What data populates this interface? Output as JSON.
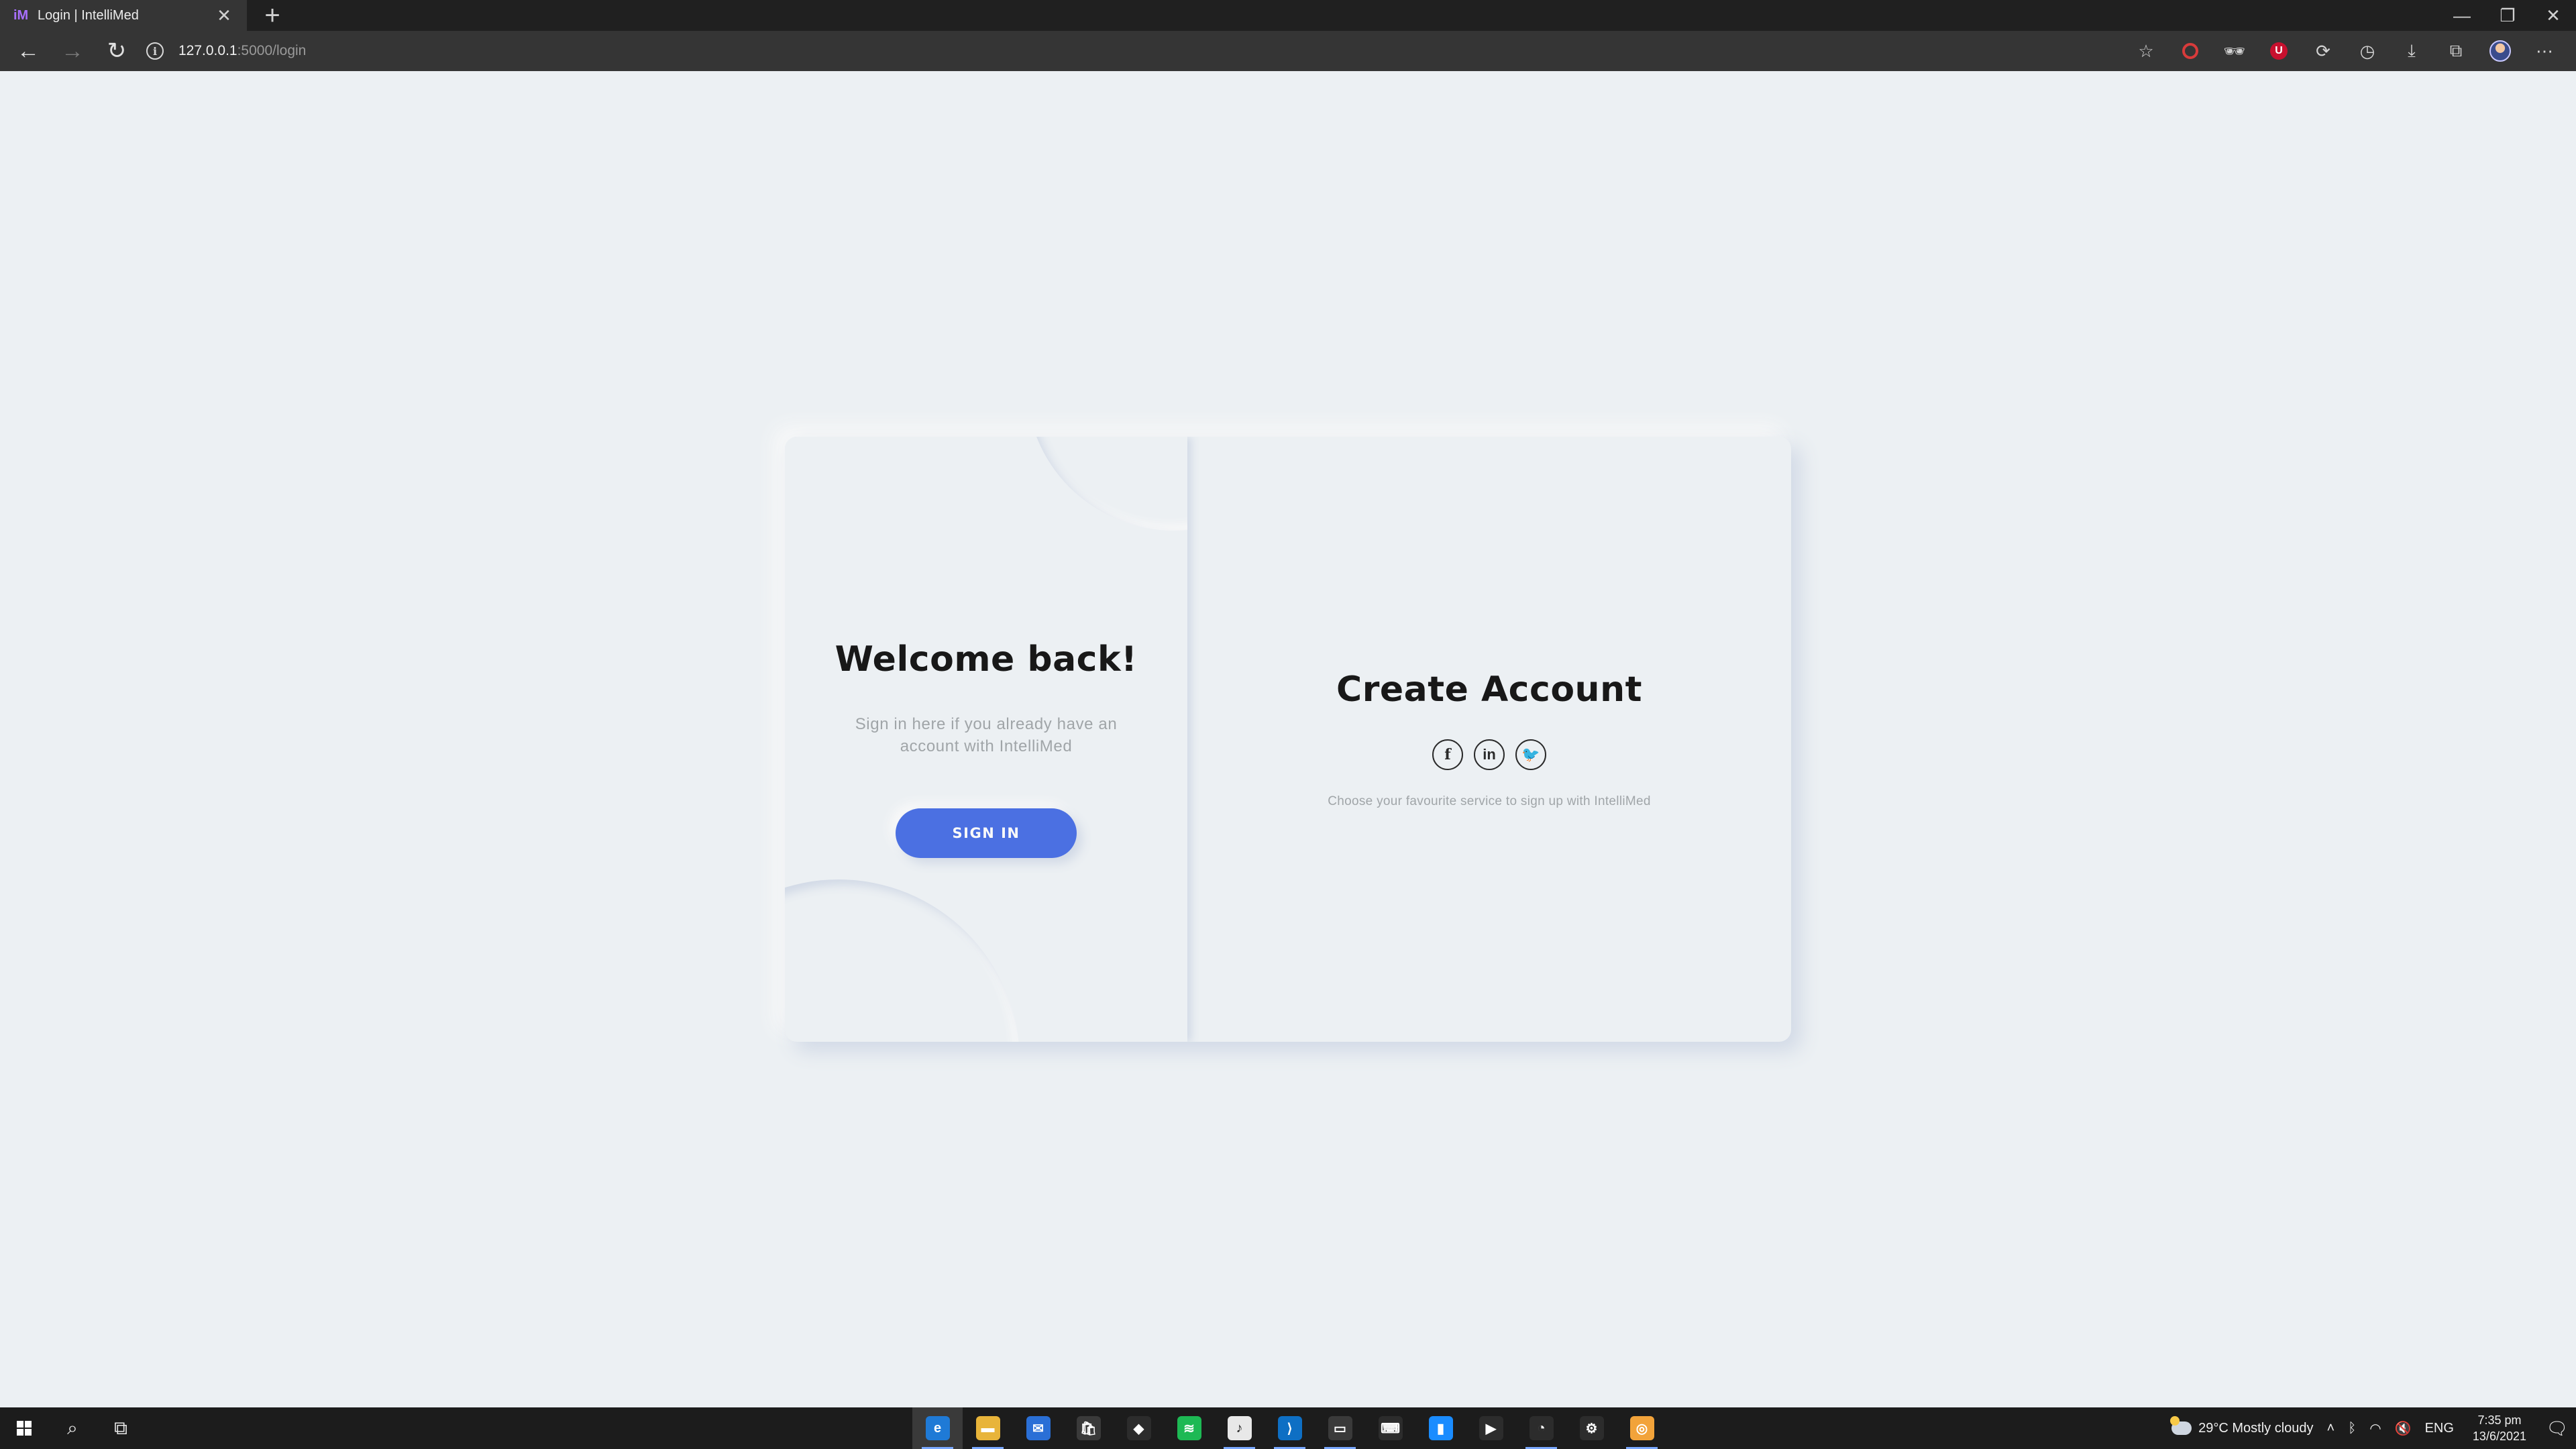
{
  "browser": {
    "tab_favicon": "iM",
    "tab_title": "Login | IntelliMed",
    "tab_close": "✕",
    "new_tab": "+",
    "url_host": "127.0.0.1",
    "url_path": ":5000/login",
    "window_controls": [
      "—",
      "❐",
      "✕"
    ],
    "extensions": [
      "favorites-icon",
      "extension-red-ring-icon",
      "extension-incognito-icon",
      "ublock-icon",
      "sync-icon",
      "history-icon",
      "downloads-icon",
      "collections-icon",
      "profile-avatar",
      "more-icon"
    ]
  },
  "login": {
    "welcome_title": "Welcome back!",
    "welcome_desc": "Sign in here if you already have an account with IntelliMed",
    "signin_label": "SIGN IN",
    "create_title": "Create Account",
    "social_hint": "Choose your favourite service to sign up with IntelliMed",
    "socials": [
      "f",
      "in",
      "🐦"
    ]
  },
  "taskbar": {
    "weather": "29°C  Mostly cloudy",
    "language": "ENG",
    "time": "7:35 pm",
    "date": "13/6/2021",
    "apps": [
      {
        "name": "edge",
        "color": "#1f7ad6",
        "label": "e",
        "active": true
      },
      {
        "name": "file-explorer",
        "color": "#e8b43a",
        "label": "▬",
        "active": true
      },
      {
        "name": "mail",
        "color": "#2a6fd6",
        "label": "✉",
        "active": false
      },
      {
        "name": "store",
        "color": "#3a3a3a",
        "label": "🛍",
        "active": false
      },
      {
        "name": "unity",
        "color": "#2c2c2c",
        "label": "◆",
        "active": false
      },
      {
        "name": "spotify",
        "color": "#1db954",
        "label": "≋",
        "active": false
      },
      {
        "name": "itunes",
        "color": "#e8e8e8",
        "label": "♪",
        "active": true
      },
      {
        "name": "vscode",
        "color": "#0e6fc4",
        "label": "⟩",
        "active": true
      },
      {
        "name": "terminal",
        "color": "#3a3a3a",
        "label": "▭",
        "active": true
      },
      {
        "name": "keyboard",
        "color": "#2c2c2c",
        "label": "⌨",
        "active": false
      },
      {
        "name": "notes",
        "color": "#1a8cff",
        "label": "▮",
        "active": false
      },
      {
        "name": "android-studio",
        "color": "#2c2c2c",
        "label": "▶",
        "active": false
      },
      {
        "name": "clock-app",
        "color": "#2c2c2c",
        "label": "◔",
        "active": true
      },
      {
        "name": "settings",
        "color": "#2c2c2c",
        "label": "⚙",
        "active": false
      },
      {
        "name": "chrome-canary",
        "color": "#f2a33a",
        "label": "◎",
        "active": true
      }
    ]
  }
}
